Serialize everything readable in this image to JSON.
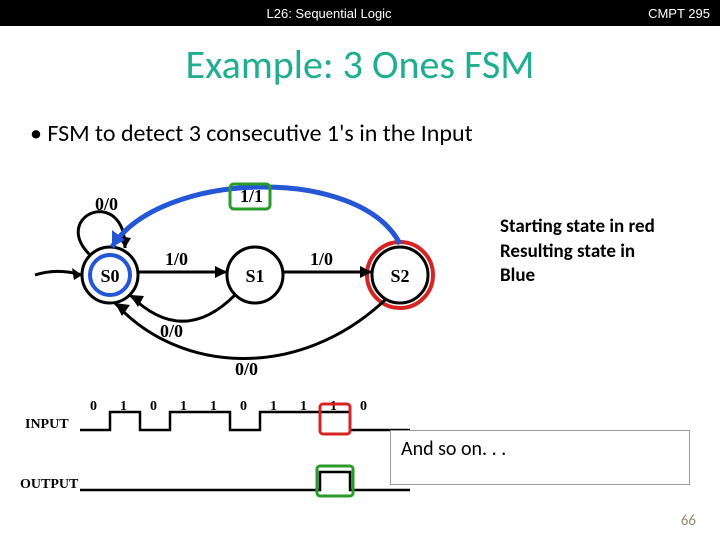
{
  "header": {
    "lecture": "L26: Sequential Logic",
    "course": "CMPT 295"
  },
  "title": "Example: 3 Ones FSM",
  "bullet_text": "FSM to detect 3 consecutive 1's in the Input",
  "fsm": {
    "states": {
      "s0": "S0",
      "s1": "S1",
      "s2": "S2"
    },
    "edges": {
      "s0_loop": "0/0",
      "s0_s1": "1/0",
      "s1_s0": "0/0",
      "s1_s2": "1/0",
      "s2_s0": "0/0",
      "s2_s0_top": "1/1"
    },
    "highlight": {
      "start": "red",
      "result": "blue",
      "edge_highlight": "green"
    }
  },
  "legend": {
    "line1": "Starting state in red",
    "line2": "Resulting state in",
    "line3": "Blue"
  },
  "timing": {
    "input_label": "INPUT",
    "output_label": "OUTPUT",
    "input_sequence": [
      0,
      1,
      0,
      1,
      1,
      0,
      1,
      1,
      1,
      0,
      0
    ],
    "output_sequence": [
      0,
      0,
      0,
      0,
      0,
      0,
      0,
      0,
      1,
      0,
      0
    ]
  },
  "and_so_on": "And so on. . .",
  "page_number": "66"
}
